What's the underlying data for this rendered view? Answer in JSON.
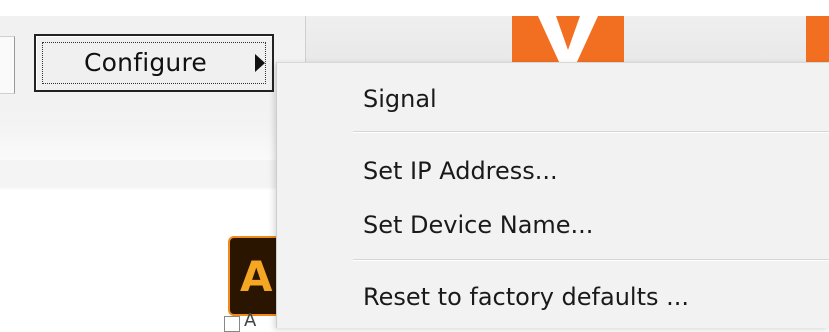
{
  "toolbar": {
    "configure_label": "Configure"
  },
  "logo": {
    "letter": "V",
    "color": "#f26f22"
  },
  "app_icon": {
    "glyph": "A",
    "caption": "A"
  },
  "context_menu": {
    "items": [
      {
        "label": "Signal"
      },
      {
        "label": "Set IP Address..."
      },
      {
        "label": "Set Device Name..."
      },
      {
        "label": "Reset to factory defaults ..."
      }
    ]
  },
  "icons": {
    "submenu_arrow": "chevron-right-icon"
  }
}
